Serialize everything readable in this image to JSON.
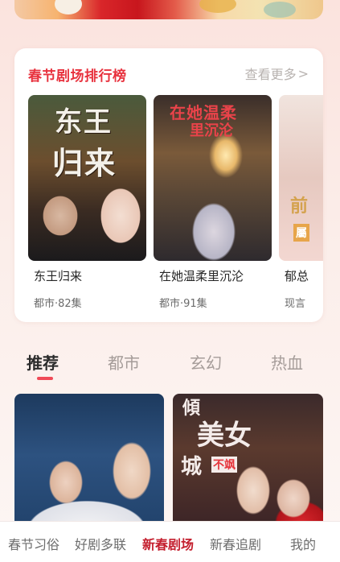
{
  "ranking": {
    "title": "春节剧场排行榜",
    "more_label": "查看更多",
    "items": [
      {
        "title": "东王归来",
        "meta": "都市·82集",
        "poster_text": [
          "东王",
          "归来"
        ]
      },
      {
        "title": "在她温柔里沉沦",
        "meta": "都市·91集",
        "poster_text": [
          "在她温柔",
          "里沉沦"
        ]
      },
      {
        "title": "郁总",
        "meta": "现言",
        "poster_text": [
          "前",
          "屬"
        ]
      }
    ]
  },
  "tabs": [
    {
      "label": "推荐"
    },
    {
      "label": "都市"
    },
    {
      "label": "玄幻"
    },
    {
      "label": "热血"
    }
  ],
  "grid": {
    "second_poster_text": [
      "傾",
      "美女",
      "城",
      "不飒"
    ]
  },
  "bottom_nav": [
    {
      "label": "春节习俗"
    },
    {
      "label": "好剧多联"
    },
    {
      "label": "新春剧场"
    },
    {
      "label": "新春追剧"
    },
    {
      "label": "我的"
    }
  ],
  "colors": {
    "accent": "#e8323e",
    "active_nav": "#c41f2e",
    "tab_indicator": "#f04a57"
  }
}
